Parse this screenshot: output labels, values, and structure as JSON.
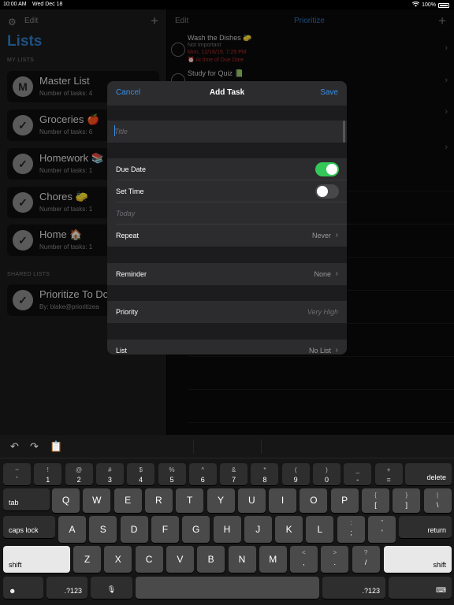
{
  "status": {
    "time": "10:00 AM",
    "date": "Wed Dec 18",
    "battery": "100%"
  },
  "sidebar": {
    "edit": "Edit",
    "title": "Lists",
    "my_lists_label": "MY LISTS",
    "shared_lists_label": "SHARED LISTS",
    "lists": [
      {
        "name": "Master List",
        "count": "Number of tasks: 4",
        "icon": "M"
      },
      {
        "name": "Groceries 🍎",
        "count": "Number of tasks: 6",
        "icon": "✓"
      },
      {
        "name": "Homework 📚",
        "count": "Number of tasks: 1",
        "icon": "✓"
      },
      {
        "name": "Chores 🧽",
        "count": "Number of tasks: 1",
        "icon": "✓"
      },
      {
        "name": "Home 🏠",
        "count": "Number of tasks: 1",
        "icon": "✓"
      }
    ],
    "shared": [
      {
        "name": "Prioritize To Do",
        "count": "By: blake@prioritizea",
        "icon": "✓"
      }
    ]
  },
  "main": {
    "edit": "Edit",
    "title": "Prioritize",
    "tasks": [
      {
        "name": "Wash the Dishes 🧽",
        "priority": "Not Important",
        "due": "Mon, 12/16/19, 7:29 PM",
        "reminder": "At time of Due Date"
      },
      {
        "name": "Study for Quiz 📗"
      }
    ]
  },
  "modal": {
    "cancel": "Cancel",
    "title": "Add Task",
    "save": "Save",
    "title_placeholder": "Title",
    "due_date_label": "Due Date",
    "due_date_on": true,
    "set_time_label": "Set Time",
    "set_time_on": false,
    "date_value": "Today",
    "repeat_label": "Repeat",
    "repeat_value": "Never",
    "reminder_label": "Reminder",
    "reminder_value": "None",
    "priority_label": "Priority",
    "priority_placeholder": "Very High",
    "list_label": "List",
    "list_value": "No List"
  },
  "keyboard": {
    "row1": [
      {
        "top": "~",
        "bot": "`"
      },
      {
        "top": "!",
        "bot": "1"
      },
      {
        "top": "@",
        "bot": "2"
      },
      {
        "top": "#",
        "bot": "3"
      },
      {
        "top": "$",
        "bot": "4"
      },
      {
        "top": "%",
        "bot": "5"
      },
      {
        "top": "^",
        "bot": "6"
      },
      {
        "top": "&",
        "bot": "7"
      },
      {
        "top": "*",
        "bot": "8"
      },
      {
        "top": "(",
        "bot": "9"
      },
      {
        "top": ")",
        "bot": "0"
      },
      {
        "top": "_",
        "bot": "-"
      },
      {
        "top": "+",
        "bot": "="
      }
    ],
    "delete": "delete",
    "tab": "tab",
    "row2": [
      "Q",
      "W",
      "E",
      "R",
      "T",
      "Y",
      "U",
      "I",
      "O",
      "P"
    ],
    "row2_sym": [
      {
        "top": "{",
        "bot": "["
      },
      {
        "top": "}",
        "bot": "]"
      },
      {
        "top": "|",
        "bot": "\\"
      }
    ],
    "caps": "caps lock",
    "row3": [
      "A",
      "S",
      "D",
      "F",
      "G",
      "H",
      "J",
      "K",
      "L"
    ],
    "row3_sym": [
      {
        "top": ":",
        "bot": ";"
      },
      {
        "top": "\"",
        "bot": "'"
      }
    ],
    "return": "return",
    "shift": "shift",
    "row4": [
      "Z",
      "X",
      "C",
      "V",
      "B",
      "N",
      "M"
    ],
    "row4_sym": [
      {
        "top": "<",
        "bot": ","
      },
      {
        "top": ">",
        "bot": "."
      },
      {
        "top": "?",
        "bot": "/"
      }
    ],
    "numbers": ".?123",
    "icons": {
      "emoji": "emoji-icon",
      "mic": "microphone-icon",
      "dismiss": "keyboard-dismiss-icon",
      "undo": "undo-icon",
      "redo": "redo-icon",
      "paste": "paste-icon"
    }
  }
}
